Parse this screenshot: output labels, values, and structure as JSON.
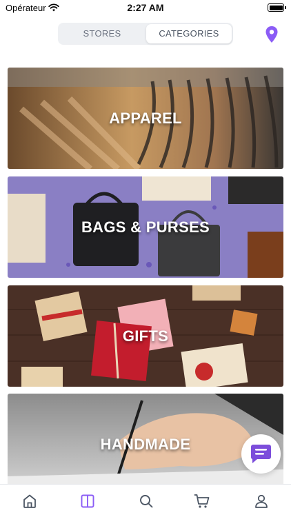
{
  "status_bar": {
    "carrier": "Opérateur",
    "time": "2:27 AM",
    "icons": [
      "wifi-icon",
      "battery-icon"
    ]
  },
  "segmented": {
    "tabs": [
      {
        "label": "STORES",
        "selected": false
      },
      {
        "label": "CATEGORIES",
        "selected": true
      }
    ]
  },
  "location": {
    "icon": "map-pin-icon",
    "color": "#8b5cf6"
  },
  "categories": [
    {
      "label": "APPAREL"
    },
    {
      "label": "BAGS & PURSES"
    },
    {
      "label": "GIFTS"
    },
    {
      "label": "HANDMADE"
    }
  ],
  "chat": {
    "icon": "chat-bubble-icon",
    "color": "#7c4ddb"
  },
  "tab_bar": {
    "items": [
      {
        "icon": "home-icon",
        "active": false
      },
      {
        "icon": "categories-icon",
        "active": true
      },
      {
        "icon": "search-icon",
        "active": false
      },
      {
        "icon": "cart-icon",
        "active": false
      },
      {
        "icon": "profile-icon",
        "active": false
      }
    ],
    "active_color": "#8b5cf6",
    "inactive_color": "#4b5563"
  }
}
